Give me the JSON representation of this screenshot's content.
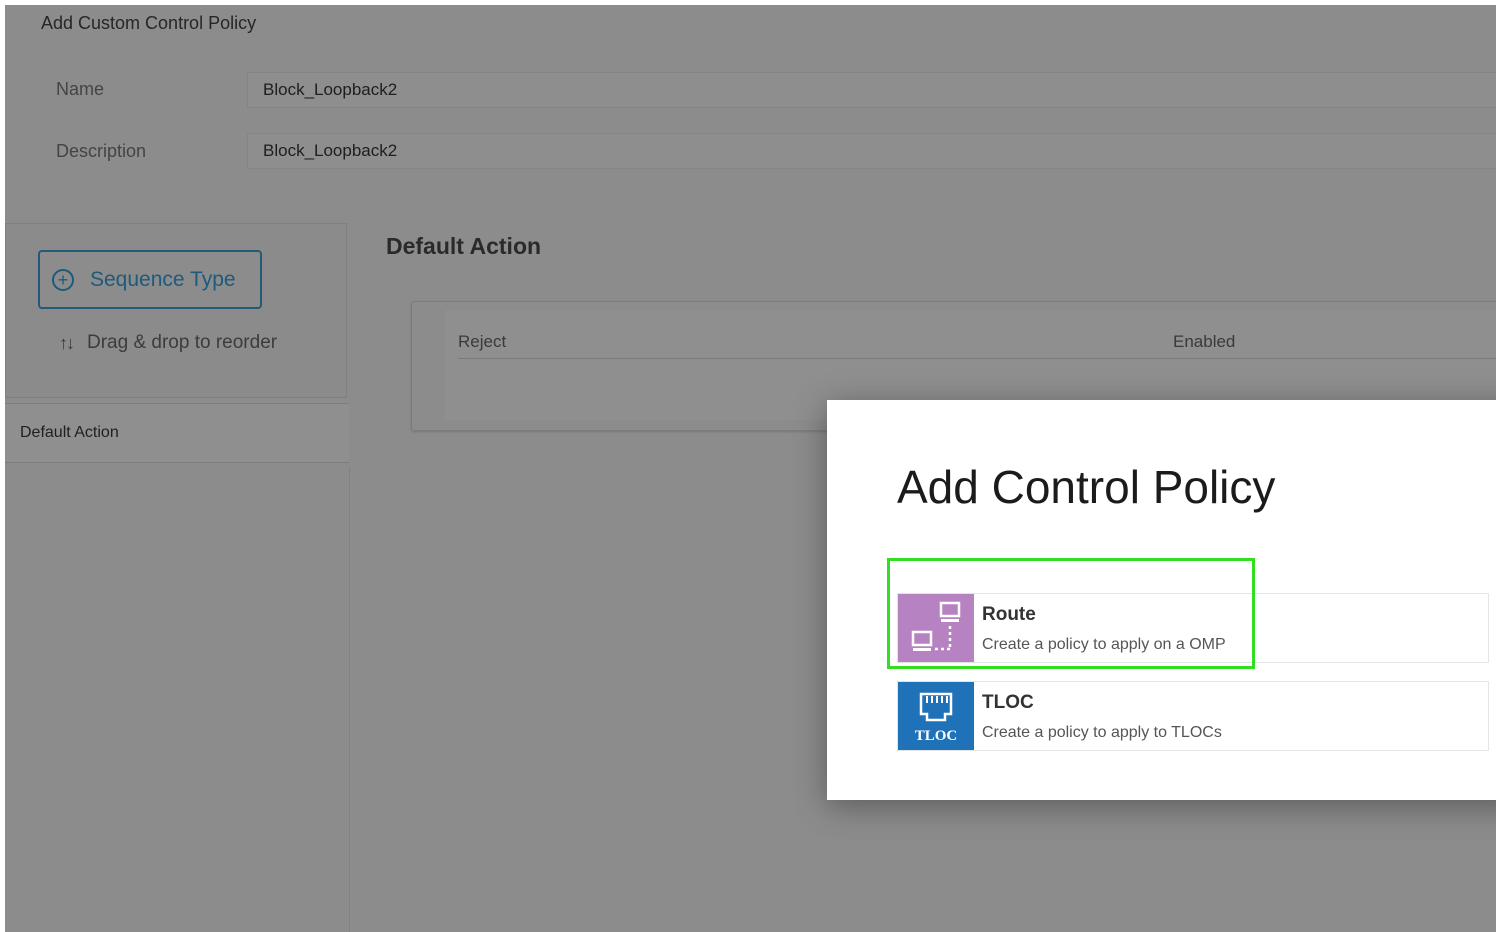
{
  "page": {
    "title": "Add Custom Control Policy",
    "name_label": "Name",
    "name_value": "Block_Loopback2",
    "description_label": "Description",
    "description_value": "Block_Loopback2"
  },
  "sidebar": {
    "sequence_type_label": "Sequence Type",
    "drag_hint": "Drag & drop to reorder",
    "items": [
      {
        "label": "Default Action"
      }
    ]
  },
  "default_action": {
    "title": "Default Action",
    "action": "Reject",
    "status": "Enabled"
  },
  "modal": {
    "title": "Add Control Policy",
    "options": [
      {
        "title": "Route",
        "description": "Create a policy to apply on a OMP",
        "icon": "route-icon",
        "color": "#b782c2"
      },
      {
        "title": "TLOC",
        "description": "Create a policy to apply to TLOCs",
        "icon": "tloc-icon",
        "color": "#1f71b8",
        "icon_text": "TLOC"
      }
    ],
    "highlight_color": "#33dd22"
  }
}
